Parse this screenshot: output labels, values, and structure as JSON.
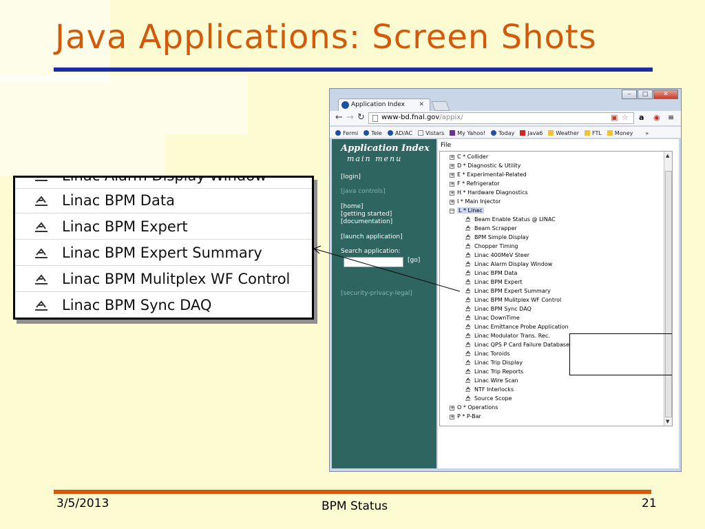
{
  "slide": {
    "title": "Java Applications: Screen Shots",
    "footer_date": "3/5/2013",
    "footer_center": "BPM Status",
    "footer_page": "21"
  },
  "browser": {
    "tab_title": "Application Index",
    "url_host": "www-bd.fnal.gov",
    "url_path": "/appix/",
    "bookmarks": [
      "Fermi",
      "Tele",
      "AD/AC",
      "Vistars",
      "My Yahoo!",
      "Today",
      "Java6",
      "Weather",
      "FTL",
      "Money"
    ],
    "bookmarks_more": "»"
  },
  "sidebar": {
    "title": "Application Index",
    "subtitle": "main menu",
    "login": "[login]",
    "java_controls": "[java controls]",
    "home": "[home]",
    "getting_started": "[getting started]",
    "documentation": "[documentation]",
    "launch": "[launch application]",
    "search_label": "Search application:",
    "go": "[go]",
    "legal": "[security-privacy-legal]"
  },
  "content": {
    "file_menu": "File",
    "categories_top": [
      "C * Collider",
      "D * Diagnostic & Utility",
      "E * Experimental-Related",
      "F * Refrigerator",
      "H * Hardware Diagnostics",
      "I * Main Injector"
    ],
    "open_category": "L * Linac",
    "linac_items": [
      "Beam Enable Status @ LINAC",
      "Beam Scrapper",
      "BPM Simple Display",
      "Chopper Timing",
      "Linac 400MeV Steer",
      "Linac Alarm Display Window",
      "Linac BPM Data",
      "Linac BPM Expert",
      "Linac BPM Expert Summary",
      "Linac BPM Mulitplex WF Control",
      "Linac BPM Sync DAQ",
      "Linac DownTime",
      "Linac Emittance Probe Application",
      "Linac Modulator Trans. Rec.",
      "Linac QPS P Card Failure Database",
      "Linac Toroids",
      "Linac Trip Display",
      "Linac Trip Reports",
      "Linac Wire Scan",
      "NTF Interlocks",
      "Source Scope"
    ],
    "categories_bottom": [
      "O * Operations",
      "P * P-Bar"
    ]
  },
  "callout": {
    "items": [
      "Linac BPM Data",
      "Linac BPM Expert",
      "Linac BPM Expert Summary",
      "Linac BPM Mulitplex WF Control",
      "Linac BPM Sync DAQ"
    ]
  },
  "colors": {
    "title": "#d25a0a",
    "title_rule": "#1c2c9c",
    "footer_rule": "#d25a0a",
    "sidebar": "#2e6561",
    "background": "#fdfbd1"
  }
}
